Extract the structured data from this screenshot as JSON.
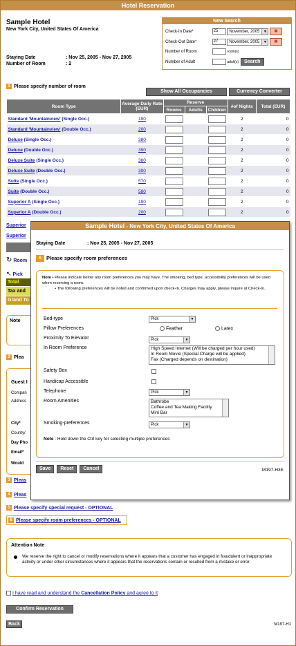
{
  "window_title": "Hotel Reservation",
  "hotel": {
    "name": "Sample Hotel",
    "city": "New York City, United States Of America"
  },
  "stay": {
    "date_label": "Staying Date",
    "date_value": ": Nov 25, 2005 - Nov 27, 2005",
    "rooms_label": "Number of Room",
    "rooms_value": ": 2"
  },
  "new_search": {
    "title": "New Search",
    "checkin_label": "Check-In Date*",
    "checkin_day": "25",
    "checkin_month": "November, 2005",
    "checkout_label": "Check-Out Date*",
    "checkout_day": "27",
    "checkout_month": "November, 2005",
    "room_label": "Number of Room",
    "room_unit": "room(s)",
    "adult_label": "Number of Adult",
    "adult_unit": "adult(s)",
    "search_button": "Search"
  },
  "section1": {
    "num": "1",
    "title": "Please specify number of room"
  },
  "buttons": {
    "show_all": "Show All Occupancies",
    "currency": "Currency Converter",
    "confirm": "Confirm Reservation",
    "back": "Back"
  },
  "table": {
    "h_room_type": "Room Type",
    "h_avg_rate": "Average Daily Rate (EUR)",
    "h_reserve": "Reserve",
    "h_rooms": "Rooms",
    "h_adults": "Adults",
    "h_children": "Children",
    "h_nights": "#of Nights",
    "h_total": "Total (EUR)",
    "rows": [
      {
        "name": "Standard 'Mountainview'",
        "occ": "(Single Occ.)",
        "rate": "190",
        "nights": "2",
        "total": "0"
      },
      {
        "name": "Standard 'Mountainview'",
        "occ": "(Double Occ.)",
        "rate": "200",
        "nights": "2",
        "total": "0"
      },
      {
        "name": "Deluxe",
        "occ": "(Single Occ.)",
        "rate": "380",
        "nights": "2",
        "total": "0"
      },
      {
        "name": "Deluxe",
        "occ": "(Double Occ.)",
        "rate": "390",
        "nights": "2",
        "total": "0"
      },
      {
        "name": "Deluxe Suite",
        "occ": "(Single Occ.)",
        "rate": "380",
        "nights": "2",
        "total": "0"
      },
      {
        "name": "Deluxe Suite",
        "occ": "(Double Occ.)",
        "rate": "390",
        "nights": "2",
        "total": "0"
      },
      {
        "name": "Suite",
        "occ": "(Single Occ.)",
        "rate": "570",
        "nights": "2",
        "total": "0"
      },
      {
        "name": "Suite",
        "occ": "(Double Occ.)",
        "rate": "580",
        "nights": "2",
        "total": "0"
      },
      {
        "name": "Superior A",
        "occ": "(Single Occ.)",
        "rate": "190",
        "nights": "2",
        "total": "0"
      },
      {
        "name": "Superior A",
        "occ": "(Double Occ.)",
        "rate": "200",
        "nights": "2",
        "total": "0"
      }
    ]
  },
  "left_fragments": {
    "superior1": "Superior",
    "superior2": "Superior",
    "room": "Room",
    "pick": "Pick",
    "total": "Total",
    "tax": "Tax and",
    "grand": "Grand To",
    "note": "Note",
    "sec2": "Plea",
    "guest": "Guest I",
    "company": "Compan",
    "address": "Address",
    "city": "City*",
    "county": "County/",
    "dayphone": "Day Pho",
    "email": "Email*",
    "would": "Would"
  },
  "modal": {
    "title_hotel": "Sample Hotel",
    "title_city": " - New York City, United States Of America",
    "stay_label": "Staying Date",
    "stay_value": ": Nov 25, 2005 - Nov 27, 2005",
    "section_num": "6",
    "section_title": "Please specify room preferences",
    "note_label": "Note",
    "note_text1": "Please indicate below any room preferences you may have. The smoking, bed type, accessibility preferences will be used when reserving a room.",
    "note_text2": "The following preferences will be noted and confirmed upon check-in. Charges may apply, please inquire at Check-In.",
    "bed_type": "Bed-type",
    "bed_type_value": "Pick",
    "pillow": "Pillow Preferences",
    "pillow_opt1": "Feather",
    "pillow_opt2": "Latex",
    "elevator": "Proximity To Elevator",
    "elevator_value": "Pick",
    "in_room": "In Room Preference",
    "in_room_opts": [
      "High Speed Internet (Will be charged per hour used)",
      "In Room Movie (Special Charge will be applied)",
      "Fax (Charged depends on destination)"
    ],
    "safety": "Safety Box",
    "handicap": "Handicap Accessible",
    "telephone": "Telephone",
    "telephone_value": "Pick",
    "amenities": "Room Amenities",
    "amenities_opts": [
      "Bathrobe",
      "Coffee and Tea Making Facility",
      "Mini Bar"
    ],
    "smoking": "Smoking-preferences",
    "smoking_value": "Pick",
    "note2_label": "Note",
    "note2_text": ": Hold down the Ctrl key for selecting multiple preferences",
    "save": "Save",
    "reset": "Reset",
    "cancel": "Cancel",
    "code": "M197-H3E"
  },
  "bottom_links": [
    {
      "num": "3",
      "text": "Pleas"
    },
    {
      "num": "4",
      "text": "Pleas"
    },
    {
      "num": "5",
      "text": "Please specify special request - OPTIONAL"
    },
    {
      "num": "6",
      "text": "Please specify room preferences - OPTIONAL"
    }
  ],
  "attention": {
    "title": "Attention Note",
    "text": "We reserve the right to cancel or modify reservations where it appears that a customer has engaged in fraudulent or inappropriate activity or under other circumstances where it appears that the reservations contain or resulted from a mistake or error."
  },
  "policy": {
    "pre": "I have read and understand the ",
    "link": "Cancellation Policy",
    "post": " and agree to it"
  },
  "footer_code": "M197-H1",
  "colors": {
    "header": "#c39049",
    "accent": "#e89a2a",
    "link": "#1a1aa6"
  }
}
